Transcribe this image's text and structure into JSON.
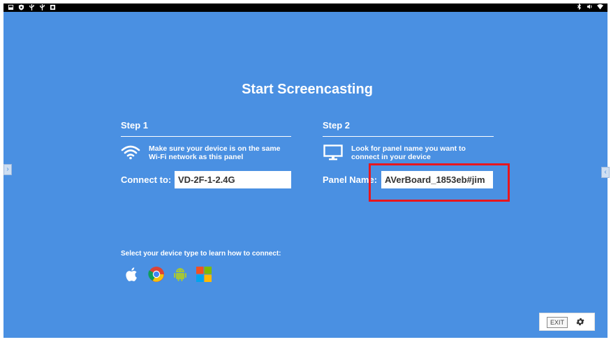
{
  "colors": {
    "background": "#4a90e2",
    "highlight": "#e8161d",
    "statusbar": "#000000"
  },
  "title": "Start Screencasting",
  "step1": {
    "title": "Step 1",
    "icon": "wifi-icon",
    "text_line1": "Make sure your device is on the same",
    "text_line2": "Wi-Fi network as this panel",
    "label": "Connect to:",
    "value": "VD-2F-1-2.4G"
  },
  "step2": {
    "title": "Step 2",
    "icon": "monitor-icon",
    "text_line1": "Look for panel name you want to",
    "text_line2": "connect in your device",
    "label": "Panel Name:",
    "value": "AVerBoard_1853eb#jim"
  },
  "device_prompt": "Select your device type to learn how to connect:",
  "device_icons": [
    "apple-icon",
    "chrome-icon",
    "android-icon",
    "windows-icon"
  ],
  "side_tabs": {
    "left": "›",
    "right": "‹"
  },
  "exit_label": "EXIT",
  "settings_icon": "gear-icon"
}
